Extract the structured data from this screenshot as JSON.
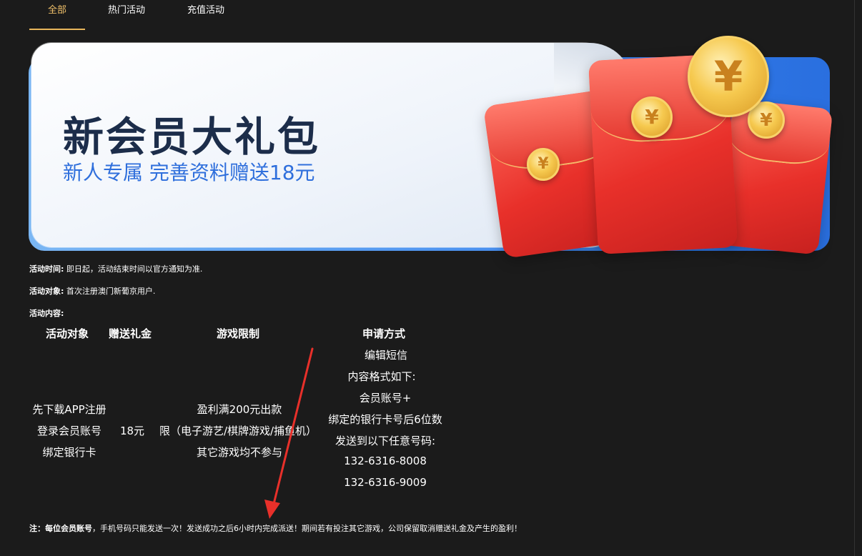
{
  "tabs": [
    {
      "label": "全部",
      "active": true
    },
    {
      "label": "热门活动",
      "active": false
    },
    {
      "label": "充值活动",
      "active": false
    }
  ],
  "banner": {
    "title": "新会员大礼包",
    "subtitle": "新人专属 完善资料赠送18元",
    "coin_symbol": "¥"
  },
  "info": {
    "time_label": "活动时间:",
    "time_value": "即日起，活动结束时间以官方通知为准.",
    "target_label": "活动对象:",
    "target_value": "首次注册澳门新葡京用户.",
    "content_label": "活动内容:"
  },
  "table": {
    "headers": [
      "活动对象",
      "赠送礼金",
      "游戏限制",
      "申请方式"
    ],
    "target_lines": [
      "先下载APP注册",
      "登录会员账号",
      "绑定银行卡"
    ],
    "gift": "18元",
    "limit_lines": [
      "盈利满200元出款",
      "限（电子游艺/棋牌游戏/捕鱼机）",
      "其它游戏均不参与"
    ],
    "apply_lines": [
      "编辑短信",
      "内容格式如下:",
      "会员账号+",
      "绑定的银行卡号后6位数",
      "发送到以下任意号码:",
      "132-6316-8008",
      "132-6316-9009"
    ]
  },
  "note": {
    "prefix": "注：每位会员账号",
    "text": "，手机号码只能发送一次！发送成功之后6小时内完成派送！期间若有投注其它游戏，公司保留取消赠送礼金及产生的盈利！"
  },
  "colors": {
    "background": "#1b1b1b",
    "tab_active": "#f0c06a",
    "banner_blue": "#2f78e6",
    "envelope_red": "#e8302a",
    "arrow_red": "#e8302a"
  }
}
